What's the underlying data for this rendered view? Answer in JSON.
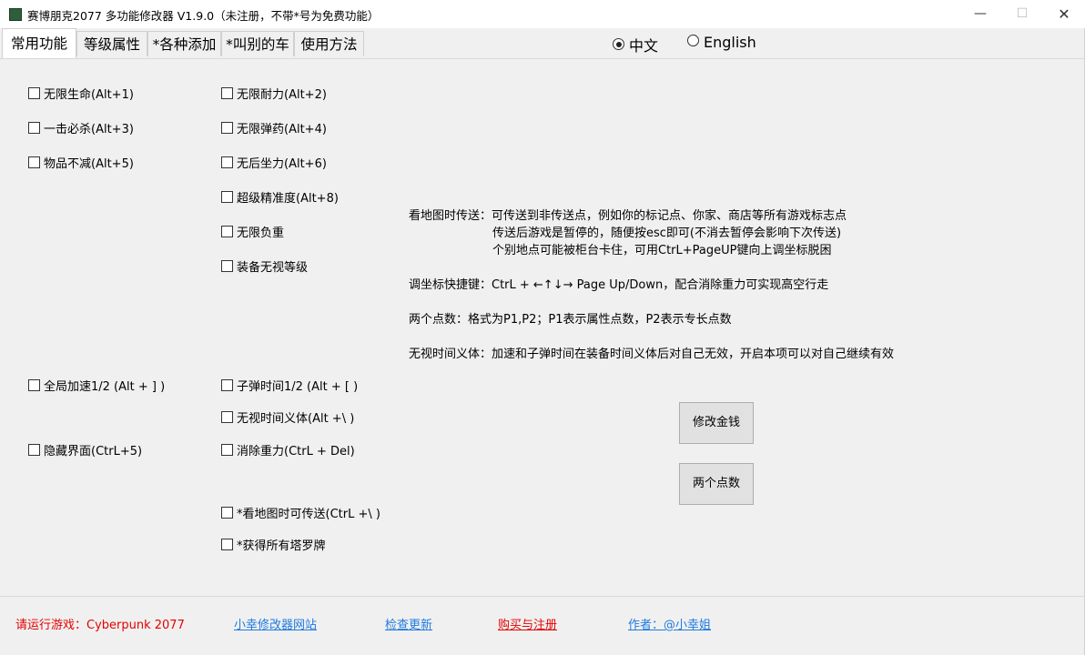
{
  "window": {
    "title": "赛博朋克2077 多功能修改器  V1.9.0（未注册，不带*号为免费功能）",
    "min_glyph": "—",
    "max_glyph": "☐",
    "close_glyph": "✕"
  },
  "tabs": [
    {
      "label": "常用功能",
      "active": true
    },
    {
      "label": "等级属性",
      "active": false
    },
    {
      "label": "*各种添加",
      "active": false
    },
    {
      "label": "*叫别的车",
      "active": false
    },
    {
      "label": "使用方法",
      "active": false
    }
  ],
  "language": {
    "options": [
      {
        "label": "中文",
        "checked": true
      },
      {
        "label": "English",
        "checked": false
      }
    ]
  },
  "checkboxes": {
    "left": [
      {
        "label": "无限生命(Alt+1)",
        "checked": false
      },
      {
        "label": "一击必杀(Alt+3)",
        "checked": false
      },
      {
        "label": "物品不减(Alt+5)",
        "checked": false
      },
      {
        "label": "全局加速1/2 (Alt + ] )",
        "checked": false
      },
      {
        "label": "隐藏界面(CtrL+5)",
        "checked": false
      }
    ],
    "middle": [
      {
        "label": "无限耐力(Alt+2)",
        "checked": false
      },
      {
        "label": "无限弹药(Alt+4)",
        "checked": false
      },
      {
        "label": "无后坐力(Alt+6)",
        "checked": false
      },
      {
        "label": "超级精准度(Alt+8)",
        "checked": false
      },
      {
        "label": "无限负重",
        "checked": false
      },
      {
        "label": "装备无视等级",
        "checked": false
      },
      {
        "label": "子弹时间1/2 (Alt + [ )",
        "checked": false
      },
      {
        "label": "无视时间义体(Alt +\\ )",
        "checked": false
      },
      {
        "label": "消除重力(CtrL + Del)",
        "checked": false
      },
      {
        "label": "*看地图时可传送(CtrL +\\ )",
        "checked": false
      },
      {
        "label": "*获得所有塔罗牌",
        "checked": false
      }
    ]
  },
  "info": {
    "teleport_1": "看地图时传送：可传送到非传送点，例如你的标记点、你家、商店等所有游戏标志点",
    "teleport_2": "传送后游戏是暂停的，随便按esc即可(不消去暂停会影响下次传送)",
    "teleport_3": "个别地点可能被柜台卡住，可用CtrL+PageUP键向上调坐标脱困",
    "coords": "调坐标快捷键：CtrL + ←↑↓→ Page Up/Down，配合消除重力可实现高空行走",
    "points": "两个点数：格式为P1,P2；P1表示属性点数，P2表示专长点数",
    "cyberware": "无视时间义体：加速和子弹时间在装备时间义体后对自己无效，开启本项可以对自己继续有效"
  },
  "buttons": {
    "money": "修改金钱",
    "points": "两个点数"
  },
  "footer": {
    "status": "请运行游戏：Cyberpunk 2077",
    "website": "小幸修改器网站",
    "update": "检查更新",
    "buy": "购买与注册",
    "author": "作者：@小幸姐"
  },
  "colors": {
    "status_red": "#e60000",
    "link_blue": "#1f7ae0",
    "button_face": "#e1e1e1"
  }
}
